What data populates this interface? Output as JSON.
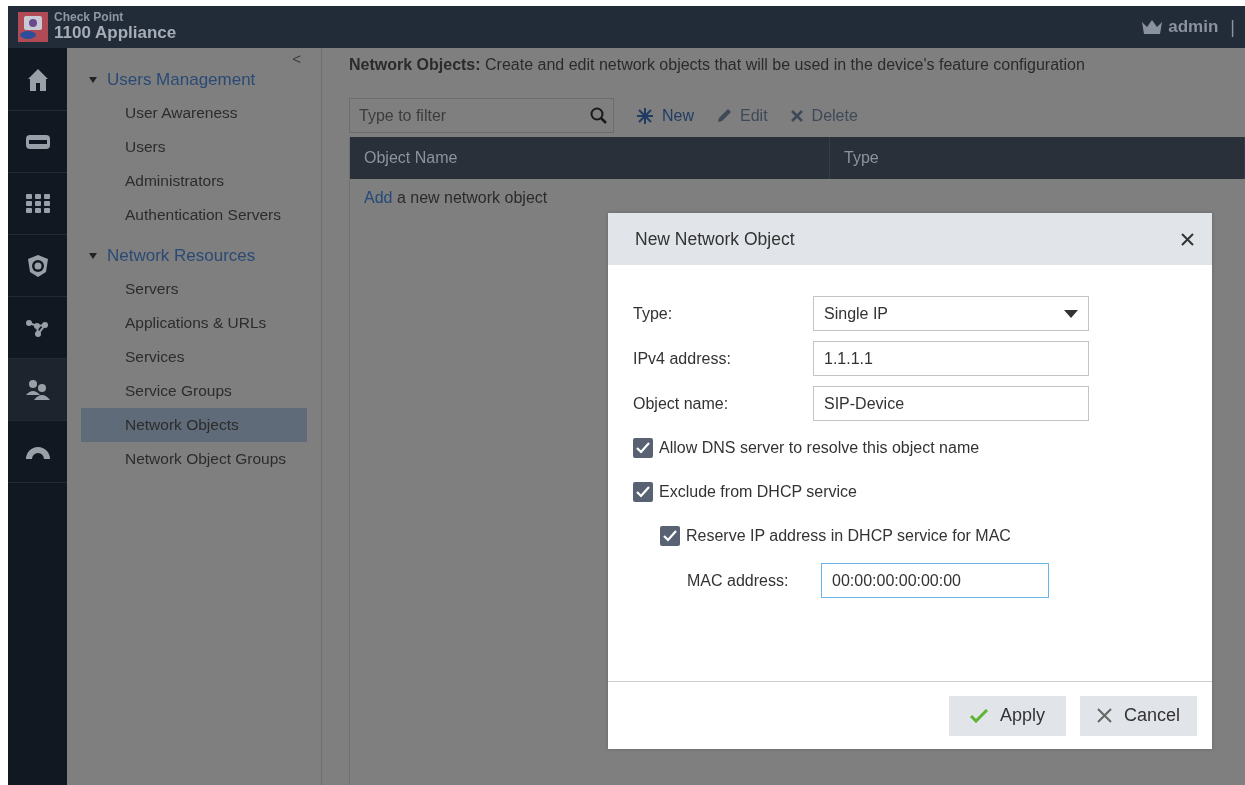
{
  "header": {
    "brand_top": "Check Point",
    "brand_bottom": "1100 Appliance",
    "user": "admin",
    "separator": "|"
  },
  "rail": [
    {
      "kind": "home",
      "selected": false
    },
    {
      "kind": "device",
      "selected": false
    },
    {
      "kind": "grid",
      "selected": false
    },
    {
      "kind": "shield",
      "selected": false
    },
    {
      "kind": "network",
      "selected": false
    },
    {
      "kind": "users",
      "selected": true
    },
    {
      "kind": "gauge",
      "selected": false
    }
  ],
  "sidebar": {
    "collapse": "<",
    "groups": [
      {
        "title": "Users Management",
        "expanded": true,
        "items": [
          {
            "label": "User Awareness",
            "selected": false
          },
          {
            "label": "Users",
            "selected": false
          },
          {
            "label": "Administrators",
            "selected": false
          },
          {
            "label": "Authentication Servers",
            "selected": false
          }
        ]
      },
      {
        "title": "Network Resources",
        "expanded": true,
        "items": [
          {
            "label": "Servers",
            "selected": false
          },
          {
            "label": "Applications & URLs",
            "selected": false
          },
          {
            "label": "Services",
            "selected": false
          },
          {
            "label": "Service Groups",
            "selected": false
          },
          {
            "label": "Network Objects",
            "selected": true
          },
          {
            "label": "Network Object Groups",
            "selected": false
          }
        ]
      }
    ]
  },
  "main": {
    "description": "**Network Objects:** Create and edit network objects that will be used in the device's feature configuration",
    "filter": {
      "placeholder": "Type to filter"
    },
    "actions": [
      {
        "kind": "new",
        "label": "New",
        "disabled": false
      },
      {
        "kind": "edit",
        "label": "Edit",
        "disabled": true
      },
      {
        "kind": "delete",
        "label": "Delete",
        "disabled": true
      }
    ],
    "table": {
      "columns": [
        "Object Name",
        "Type"
      ],
      "empty_link": "Add",
      "empty_text": " a new network object"
    }
  },
  "dialog": {
    "title": "New Network Object",
    "rows": [
      {
        "kind": "select",
        "label": "Type:",
        "value": "Single IP"
      },
      {
        "kind": "text",
        "label": "IPv4 address:",
        "value": "1.1.1.1",
        "focused": false
      },
      {
        "kind": "text",
        "label": "Object name:",
        "value": "SIP-Device",
        "focused": false
      },
      {
        "kind": "checkbox",
        "label": "Allow DNS server to resolve this object name",
        "checked": true
      },
      {
        "kind": "checkbox",
        "label": "Exclude from DHCP service",
        "checked": true,
        "children": [
          {
            "kind": "checkbox",
            "label": "Reserve IP address in DHCP service for MAC",
            "checked": true,
            "children": [
              {
                "kind": "text",
                "label": "MAC address:",
                "value": "00:00:00:00:00:00",
                "focused": true
              }
            ]
          }
        ]
      }
    ],
    "buttons": [
      {
        "kind": "apply",
        "label": "Apply"
      },
      {
        "kind": "cancel",
        "label": "Cancel"
      }
    ]
  }
}
